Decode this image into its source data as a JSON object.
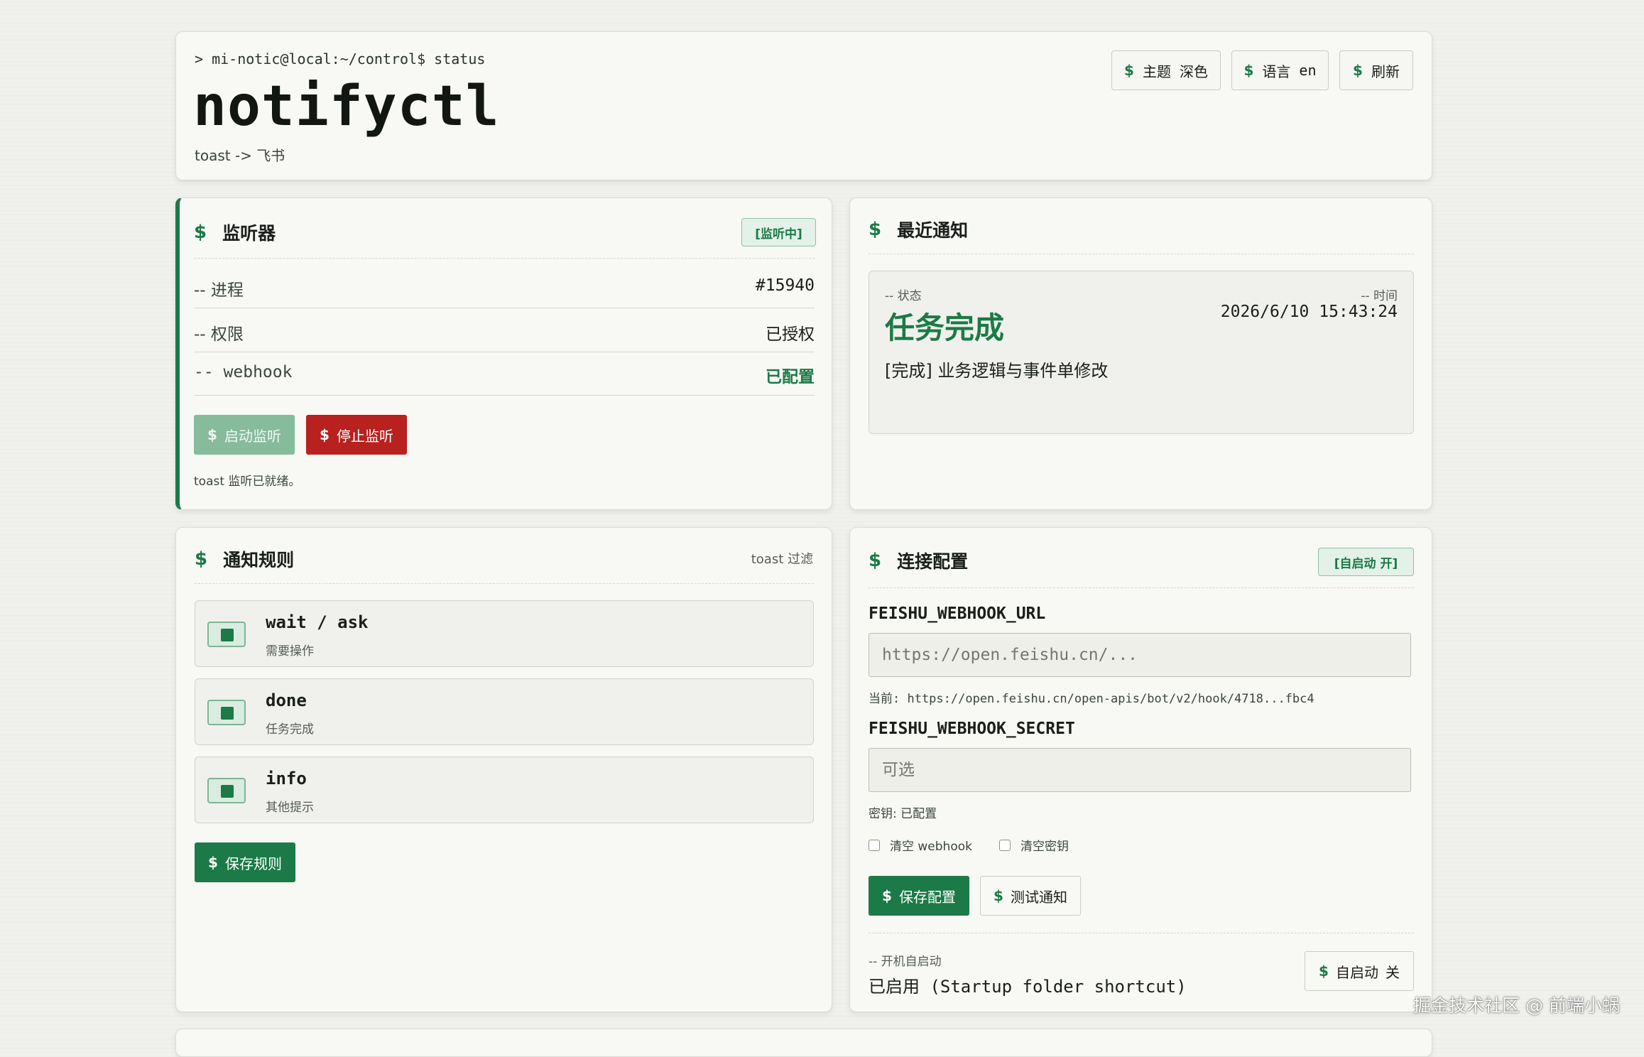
{
  "header": {
    "prompt": "> mi-notic@local:~/control$ status",
    "title": "notifyctl",
    "subtitle": "toast -> 飞书",
    "buttons": [
      {
        "prefix": "$",
        "label": "主题",
        "value": "深色"
      },
      {
        "prefix": "$",
        "label": "语言",
        "value": "en"
      },
      {
        "prefix": "$",
        "label": "刷新",
        "value": ""
      }
    ]
  },
  "listener": {
    "title": "监听器",
    "badge": "[监听中]",
    "rows": [
      {
        "key": "-- 进程",
        "value": "#15940"
      },
      {
        "key": "-- 权限",
        "value": "已授权"
      },
      {
        "key": "-- webhook",
        "value": "已配置"
      }
    ],
    "start_label": "启动监听",
    "stop_label": "停止监听",
    "status": "toast 监听已就绪。"
  },
  "recent": {
    "title": "最近通知",
    "status_label": "-- 状态",
    "time_label": "-- 时间",
    "status_value": "任务完成",
    "time_value": "2026/6/10 15:43:24",
    "message": "[完成] 业务逻辑与事件单修改"
  },
  "rules": {
    "title": "通知规则",
    "hint": "toast 过滤",
    "items": [
      {
        "name": "wait / ask",
        "desc": "需要操作",
        "enabled": true
      },
      {
        "name": "done",
        "desc": "任务完成",
        "enabled": true
      },
      {
        "name": "info",
        "desc": "其他提示",
        "enabled": true
      }
    ],
    "save_label": "保存规则"
  },
  "connection": {
    "title": "连接配置",
    "badge": "[自启动 开]",
    "url_label": "FEISHU_WEBHOOK_URL",
    "url_placeholder": "https://open.feishu.cn/...",
    "url_current": "当前: https://open.feishu.cn/open-apis/bot/v2/hook/4718...fbc4",
    "secret_label": "FEISHU_WEBHOOK_SECRET",
    "secret_placeholder": "可选",
    "secret_status": "密钥: 已配置",
    "clear_webhook_label": "清空 webhook",
    "clear_secret_label": "清空密钥",
    "save_label": "保存配置",
    "test_label": "测试通知",
    "autostart_label": "-- 开机自启动",
    "autostart_value": "已启用 (Startup folder shortcut)",
    "autostart_button_label": "自启动",
    "autostart_button_value": "关"
  },
  "watermark": "掘金技术社区 @ 前端小蜗",
  "colors": {
    "accent": "#1b7a47",
    "danger": "#b8211e",
    "background": "#f0f0ec",
    "card": "#f8f8f4"
  }
}
